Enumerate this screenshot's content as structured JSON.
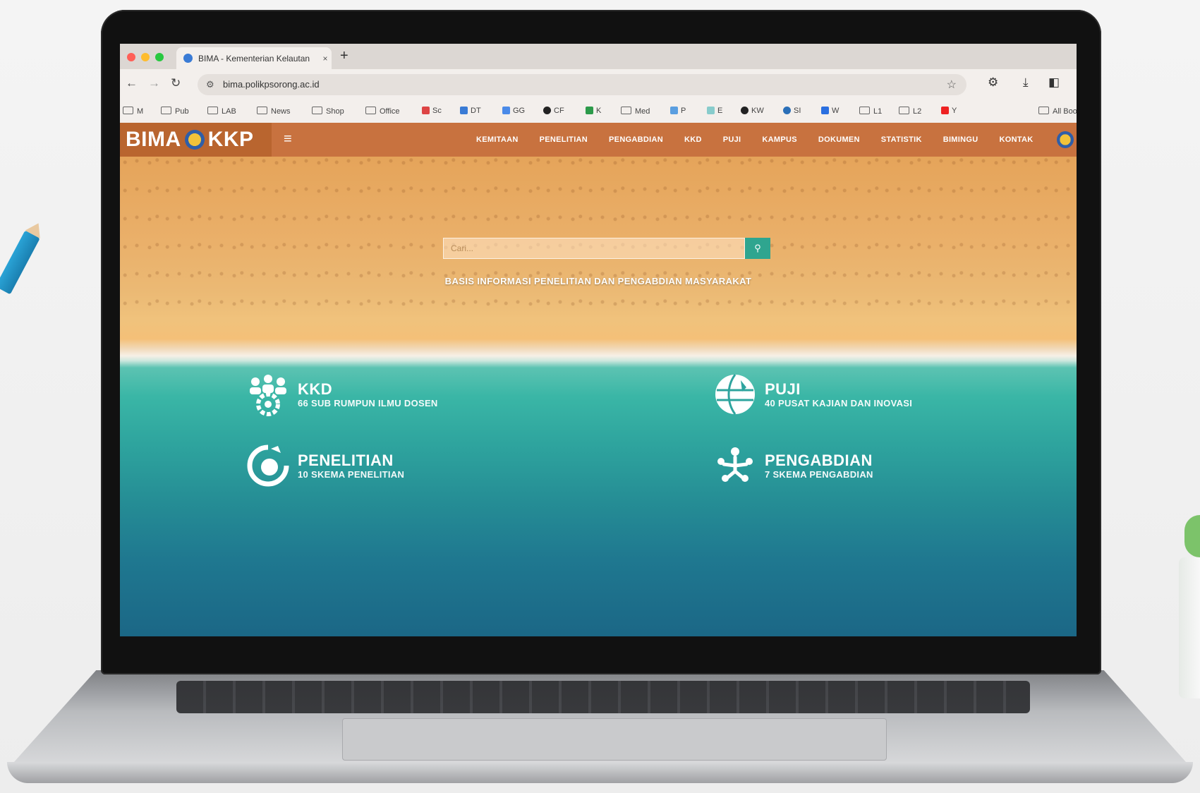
{
  "browser": {
    "tab_title": "BIMA - Kementerian Kelautan",
    "tab_close": "×",
    "new_tab": "+",
    "url": "bima.polikpsorong.ac.id",
    "bookmarks": [
      "M",
      "Pub",
      "LAB",
      "News",
      "Shop",
      "Office",
      "Sc",
      "DT",
      "GG",
      "CF",
      "K",
      "Med",
      "P",
      "E",
      "KW",
      "SI",
      "W",
      "L1",
      "L2",
      "Y",
      "All Bookmarks"
    ]
  },
  "site": {
    "brand_left": "BIMA",
    "brand_right": "KKP",
    "menu": [
      "KEMITAAN",
      "PENELITIAN",
      "PENGABDIAN",
      "KKD",
      "PUJI",
      "KAMPUS",
      "DOKUMEN",
      "STATISTIK",
      "BIMINGU",
      "KONTAK"
    ]
  },
  "hero": {
    "search_placeholder": "Cari...",
    "search_button_icon": "search-icon",
    "tagline": "BASIS INFORMASI PENELITIAN DAN PENGABDIAN MASYARAKAT",
    "stats": [
      {
        "title": "KKD",
        "sub": "66 SUB RUMPUN ILMU DOSEN",
        "icon": "people-gear-icon"
      },
      {
        "title": "PUJI",
        "sub": "40 PUSAT KAJIAN DAN INOVASI",
        "icon": "globe-icon"
      },
      {
        "title": "PENELITIAN",
        "sub": "10 SKEMA PENELITIAN",
        "icon": "research-icon"
      },
      {
        "title": "PENGABDIAN",
        "sub": "7 SKEMA PENGABDIAN",
        "icon": "community-icon"
      }
    ]
  },
  "colors": {
    "nav_orange": "#c8723f",
    "brand_orange": "#b9652f",
    "search_button": "#2fa58f"
  }
}
